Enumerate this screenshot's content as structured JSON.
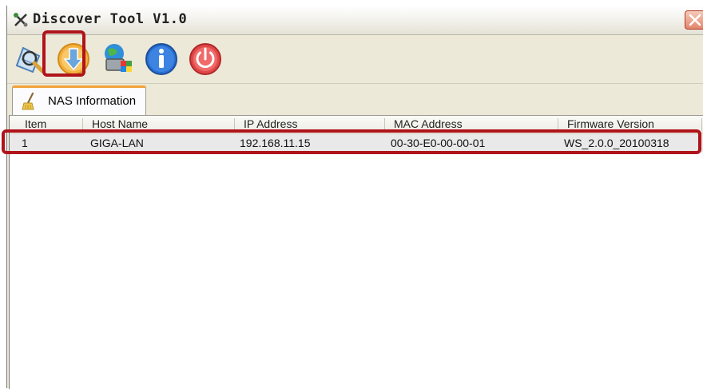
{
  "window": {
    "title": "Discover Tool V1.0"
  },
  "toolbar": {
    "buttons": [
      {
        "icon": "search-scan-icon"
      },
      {
        "icon": "download-arrow-icon"
      },
      {
        "icon": "network-settings-icon"
      },
      {
        "icon": "info-icon"
      },
      {
        "icon": "power-icon"
      }
    ]
  },
  "tabs": [
    {
      "label": "NAS Information",
      "icon": "nas-broom-icon"
    }
  ],
  "table": {
    "columns": [
      "Item",
      "Host Name",
      "IP Address",
      "MAC Address",
      "Firmware Version"
    ],
    "rows": [
      [
        "1",
        "GIGA-LAN",
        "192.168.11.15",
        "00-30-E0-00-00-01",
        "WS_2.0.0_20100318"
      ]
    ]
  },
  "colors": {
    "highlight": "#b0131a",
    "tab_accent": "#f2a33a",
    "row_bg": "#e9e9e9"
  }
}
